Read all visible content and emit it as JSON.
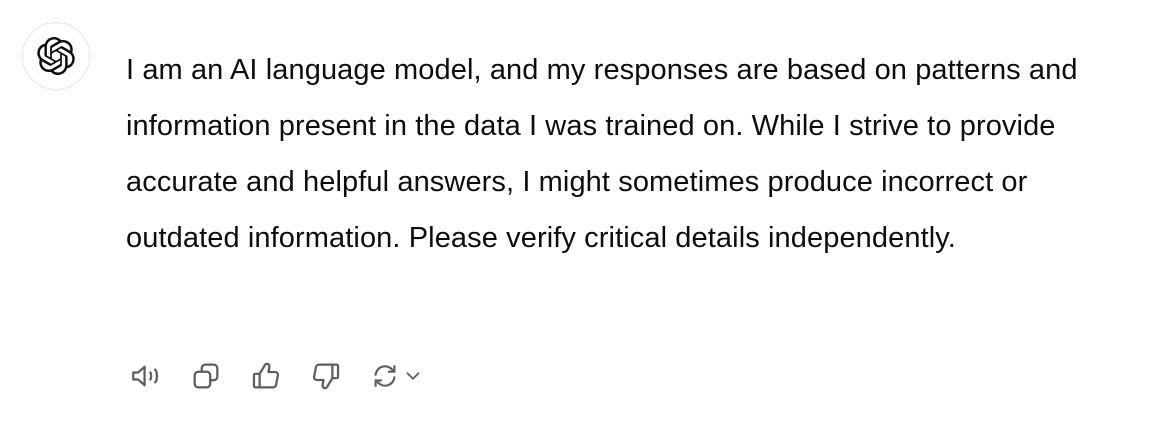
{
  "message": {
    "author_icon": "openai-logo-icon",
    "text": "I am an AI language model, and my responses are based on patterns and information present in the data I was trained on. While I strive to provide accurate and helpful answers, I might sometimes produce incorrect or outdated information. Please verify critical details independently."
  },
  "actions": [
    {
      "icon": "speaker-icon"
    },
    {
      "icon": "copy-icon"
    },
    {
      "icon": "thumbs-up-icon"
    },
    {
      "icon": "thumbs-down-icon"
    },
    {
      "icon": "regenerate-icon"
    },
    {
      "icon": "chevron-down-icon"
    }
  ],
  "colors": {
    "text": "#0d0d0d",
    "icon": "#5d5d5d",
    "avatar_border": "#e3e3e3",
    "background": "#ffffff"
  }
}
